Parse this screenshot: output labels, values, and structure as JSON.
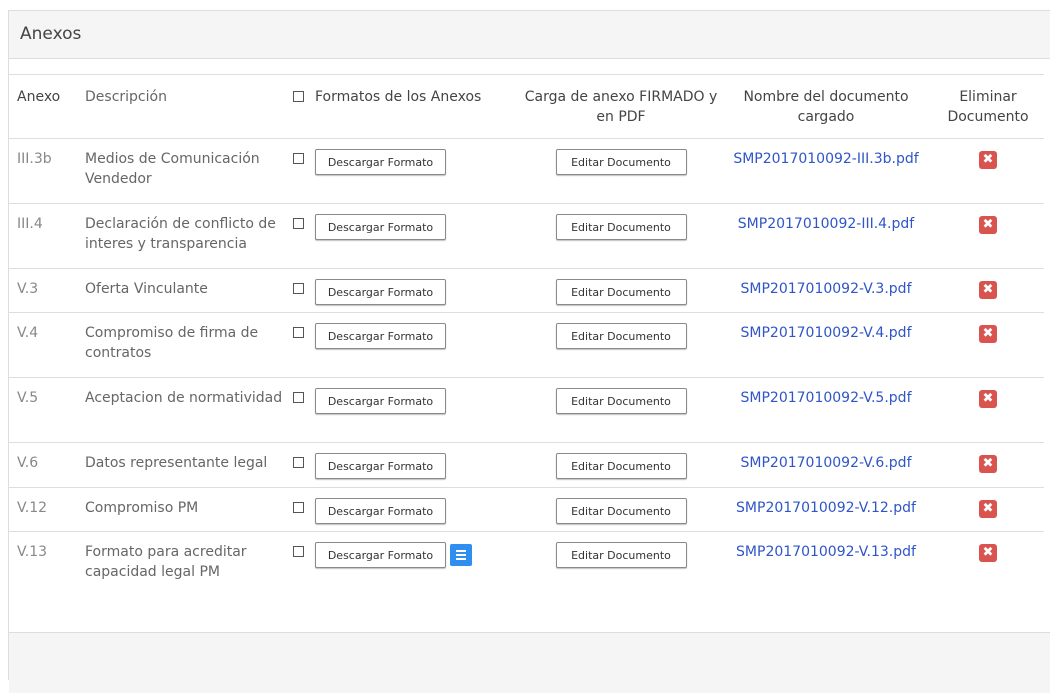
{
  "panel": {
    "title": "Anexos"
  },
  "table": {
    "headers": {
      "anexo": "Anexo",
      "descripcion": "Descripción",
      "formatos": "Formatos de los Anexos",
      "carga": "Carga de anexo FIRMADO y en PDF",
      "nombre": "Nombre del documento cargado",
      "eliminar": "Eliminar Documento"
    },
    "button_labels": {
      "descargar": "Descargar Formato",
      "editar": "Editar Documento"
    },
    "rows": [
      {
        "anexo": "III.3b",
        "descripcion": "Medios de Comunicación Vendedor",
        "documento": "SMP2017010092-III.3b.pdf"
      },
      {
        "anexo": "III.4",
        "descripcion": "Declaración de conflicto de interes y transparencia",
        "documento": "SMP2017010092-III.4.pdf"
      },
      {
        "anexo": "V.3",
        "descripcion": "Oferta Vinculante",
        "documento": "SMP2017010092-V.3.pdf"
      },
      {
        "anexo": "V.4",
        "descripcion": "Compromiso de firma de contratos",
        "documento": "SMP2017010092-V.4.pdf"
      },
      {
        "anexo": "V.5",
        "descripcion": "Aceptacion de normatividad",
        "documento": "SMP2017010092-V.5.pdf"
      },
      {
        "anexo": "V.6",
        "descripcion": "Datos representante legal",
        "documento": "SMP2017010092-V.6.pdf"
      },
      {
        "anexo": "V.12",
        "descripcion": "Compromiso PM",
        "documento": "SMP2017010092-V.12.pdf"
      },
      {
        "anexo": "V.13",
        "descripcion": "Formato para acreditar capacidad legal PM",
        "documento": "SMP2017010092-V.13.pdf"
      }
    ]
  },
  "icons": {
    "delete": "delete-icon",
    "list": "list-icon"
  },
  "colors": {
    "link": "#2f55c8",
    "delete": "#d9534f",
    "list_button": "#2e8ff0",
    "panel_bg": "#f5f5f5"
  }
}
